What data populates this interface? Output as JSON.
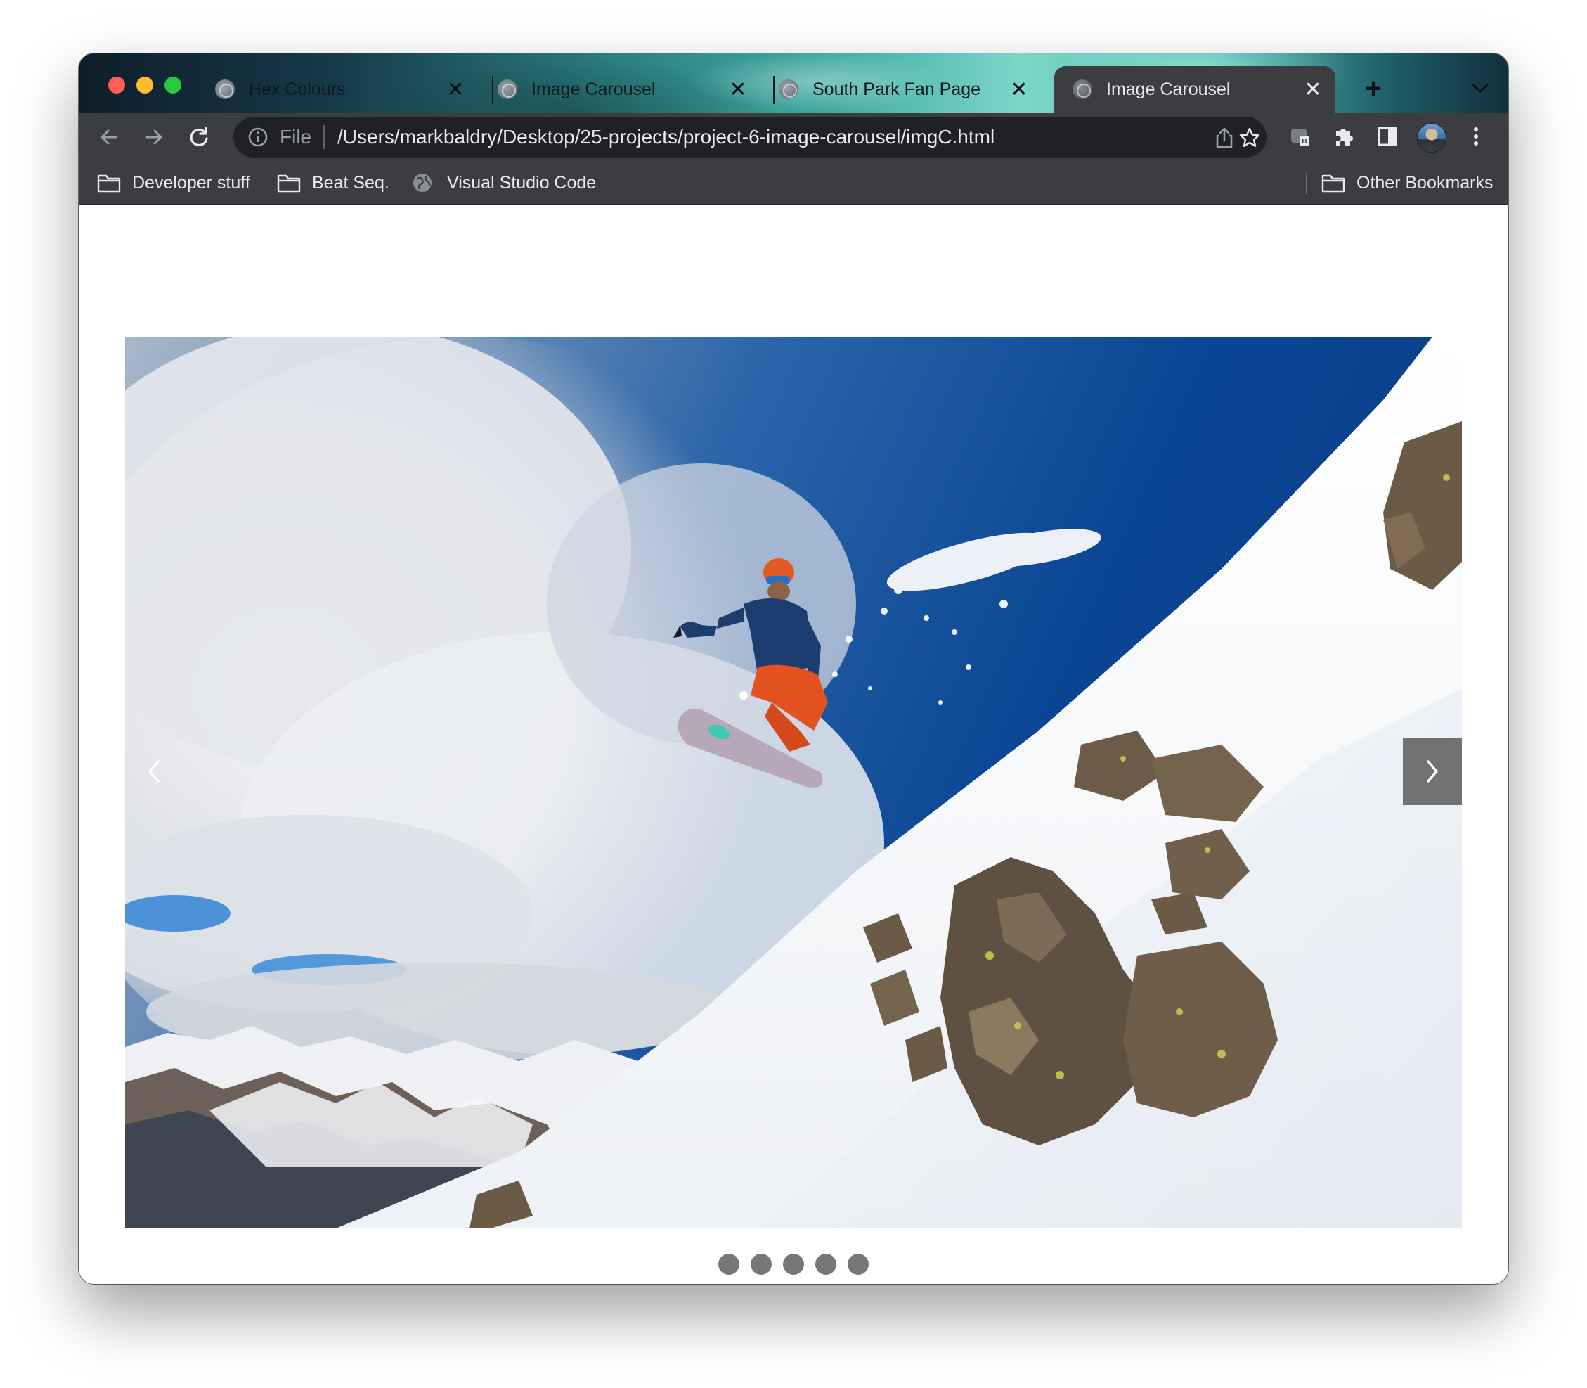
{
  "browser": {
    "tabs": [
      {
        "title": "Hex Colours",
        "active": false
      },
      {
        "title": "Image Carousel",
        "active": false
      },
      {
        "title": "South Park Fan Page",
        "active": false
      },
      {
        "title": "Image Carousel",
        "active": true
      }
    ],
    "close_glyph": "✕",
    "new_tab_glyph": "+",
    "address_bar": {
      "scheme_label": "File",
      "url": "/Users/markbaldry/Desktop/25-projects/project-6-image-carousel/imgC.html"
    },
    "bookmarks": [
      {
        "label": "Developer stuff",
        "icon": "folder-icon"
      },
      {
        "label": "Beat Seq.",
        "icon": "folder-icon"
      },
      {
        "label": "Visual Studio Code",
        "icon": "globe-icon"
      }
    ],
    "other_bookmarks": "Other Bookmarks"
  },
  "page": {
    "carousel": {
      "image_subject": "snowboarder-jump",
      "prev_icon": "chevron-left-icon",
      "next_icon": "chevron-right-icon",
      "dot_count": 5
    }
  },
  "colors": {
    "window_chrome": "#3c3d40",
    "omnibox": "#202124",
    "dot": "#777777",
    "next_button": "#555555"
  }
}
